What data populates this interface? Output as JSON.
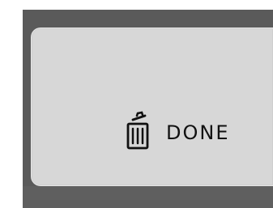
{
  "dialog": {
    "actions": [
      {
        "label": "DONE",
        "icon": "trash-icon"
      }
    ]
  },
  "colors": {
    "backdrop": "#5a5a5a",
    "dialog_background": "#d7d7d7",
    "text": "#111111"
  }
}
